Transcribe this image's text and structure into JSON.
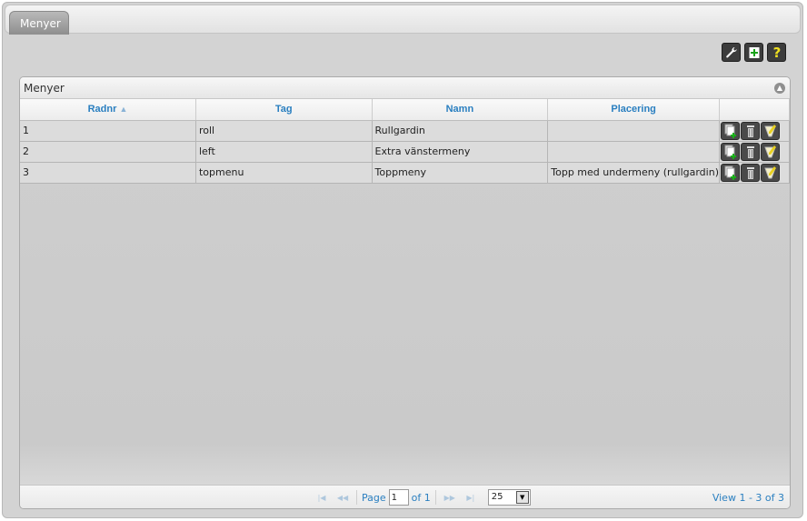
{
  "tab": {
    "label": "Menyer"
  },
  "toolbar": {
    "buttons": [
      {
        "icon": "wrench-icon"
      },
      {
        "icon": "add-icon"
      },
      {
        "icon": "help-icon"
      }
    ]
  },
  "grid": {
    "caption": "Menyer",
    "columns": [
      "Radnr",
      "Tag",
      "Namn",
      "Placering"
    ],
    "sorted_column": "Radnr",
    "rows": [
      {
        "radnr": "1",
        "tag": "roll",
        "namn": "Rullgardin",
        "placering": ""
      },
      {
        "radnr": "2",
        "tag": "left",
        "namn": "Extra vänstermeny",
        "placering": ""
      },
      {
        "radnr": "3",
        "tag": "topmenu",
        "namn": "Toppmeny",
        "placering": "Topp med undermeny (rullgardin)"
      }
    ]
  },
  "pager": {
    "page_label": "Page",
    "page_value": "1",
    "of_label": "of 1",
    "rows_per_page": "25",
    "view_text": "View 1 - 3 of 3"
  },
  "colors": {
    "accent": "#2a7fc0",
    "tab": "#9a9a9a",
    "panel_bg": "#d3d3d3"
  }
}
